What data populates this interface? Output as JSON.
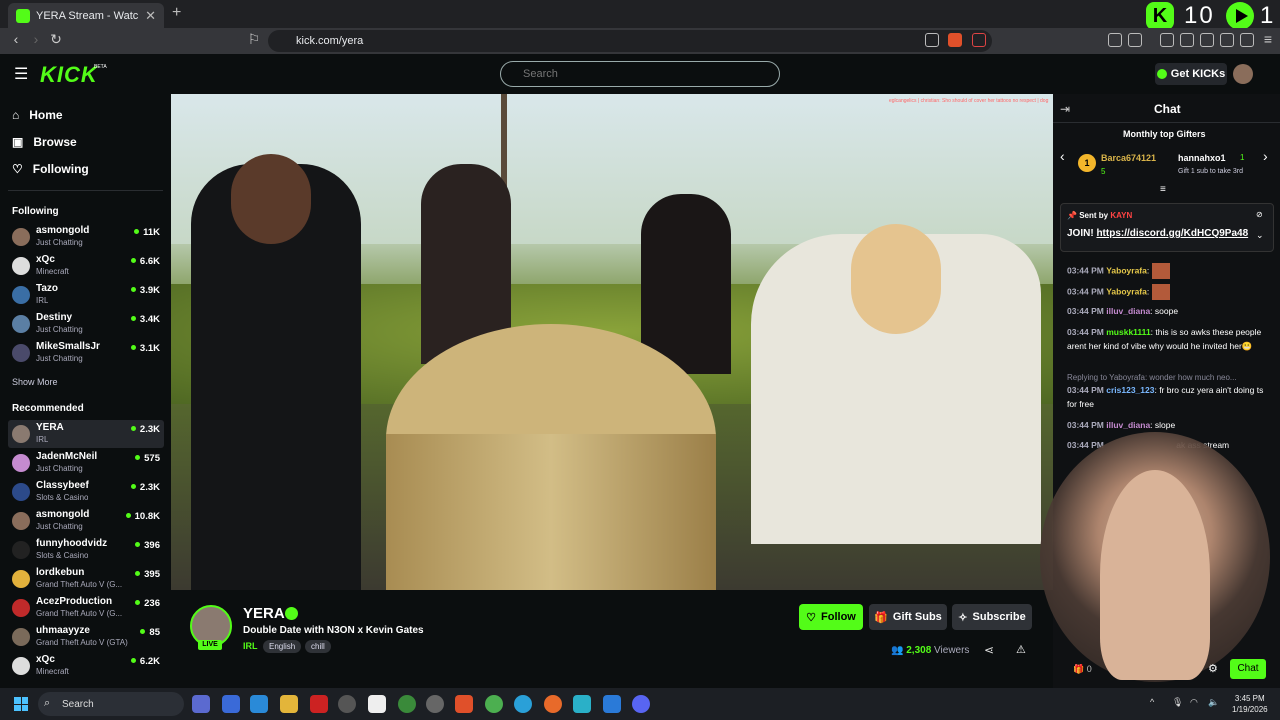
{
  "browser": {
    "tab_title": "YERA Stream - Watch Live on Kick",
    "url": "kick.com/yera",
    "ext_counter": "10",
    "ext_extra": "1"
  },
  "header": {
    "logo": "KICK",
    "beta": "BETA",
    "search_placeholder": "Search",
    "get_kicks": "Get KICKs"
  },
  "sidebar": {
    "nav": [
      {
        "label": "Home",
        "icon": "home-icon"
      },
      {
        "label": "Browse",
        "icon": "browse-icon"
      },
      {
        "label": "Following",
        "icon": "heart-icon"
      }
    ],
    "following_heading": "Following",
    "following": [
      {
        "name": "asmongold",
        "category": "Just Chatting",
        "viewers": "11K",
        "color": "#8a6d5b"
      },
      {
        "name": "xQc",
        "category": "Minecraft",
        "viewers": "6.6K",
        "color": "#ddd"
      },
      {
        "name": "Tazo",
        "category": "IRL",
        "viewers": "3.9K",
        "color": "#3a6ea5"
      },
      {
        "name": "Destiny",
        "category": "Just Chatting",
        "viewers": "3.4K",
        "color": "#5b7fa4"
      },
      {
        "name": "MikeSmallsJr",
        "category": "Just Chatting",
        "viewers": "3.1K",
        "color": "#4a4a6a"
      }
    ],
    "show_more": "Show More",
    "recommended_heading": "Recommended",
    "recommended": [
      {
        "name": "YERA",
        "category": "IRL",
        "viewers": "2.3K",
        "color": "#8a7a70"
      },
      {
        "name": "JadenMcNeil",
        "category": "Just Chatting",
        "viewers": "575",
        "color": "#c58bd0"
      },
      {
        "name": "Classybeef",
        "category": "Slots & Casino",
        "viewers": "2.3K",
        "color": "#2c4a8a"
      },
      {
        "name": "asmongold",
        "category": "Just Chatting",
        "viewers": "10.8K",
        "color": "#8a6d5b"
      },
      {
        "name": "funnyhoodvidz",
        "category": "Slots & Casino",
        "viewers": "396",
        "color": "#222"
      },
      {
        "name": "lordkebun",
        "category": "Grand Theft Auto V (G...",
        "viewers": "395",
        "color": "#e2b13c"
      },
      {
        "name": "AcezProduction",
        "category": "Grand Theft Auto V (G...",
        "viewers": "236",
        "color": "#c02a2a"
      },
      {
        "name": "uhmaayyze",
        "category": "Grand Theft Auto V (GTA)",
        "viewers": "85",
        "color": "#7a6a5a"
      },
      {
        "name": "xQc",
        "category": "Minecraft",
        "viewers": "6.2K",
        "color": "#ddd"
      }
    ]
  },
  "video": {
    "overlay_chat": "eglcangelics | christian: Sho should of cover her tattoos no respect | dog"
  },
  "stream": {
    "name": "YERA",
    "title": "Double Date with N3ON x Kevin Gates",
    "category": "IRL",
    "tags": [
      "English",
      "chill"
    ],
    "live": "LIVE",
    "viewers": "2,308",
    "viewers_label": "Viewers",
    "follow": "Follow",
    "gift_subs": "Gift Subs",
    "subscribe": "Subscribe"
  },
  "chat": {
    "title": "Chat",
    "gifters_heading": "Monthly top Gifters",
    "gifter1": {
      "rank": "1",
      "name": "Barca674121",
      "count": "5"
    },
    "gifter2": {
      "name": "hannahxo1",
      "count": "1",
      "note": "Gift 1 sub to take 3rd"
    },
    "pinned_by": "Sent by",
    "pinned_user": "KAYN",
    "pinned_msg_prefix": "JOIN!",
    "pinned_link": "https://discord.gg/KdHCQ9Pa48",
    "messages": [
      {
        "time": "03:44 PM",
        "user": "Yaboyrafa",
        "text": "",
        "color": "#e5c84a"
      },
      {
        "time": "03:44 PM",
        "user": "Yaboyrafa",
        "text": "",
        "color": "#e5c84a"
      },
      {
        "time": "03:44 PM",
        "user": "illuv_diana",
        "text": "soope",
        "color": "#c58bd0"
      },
      {
        "time": "03:44 PM",
        "user": "muskk1111",
        "text": "this is so awks these people arent her kind of vibe why would he invited her😬",
        "color": "#53fc18"
      }
    ],
    "reply": "Replying to Yaboyrafa: wonder how much neo...",
    "messages2": [
      {
        "time": "03:44 PM",
        "user": "cris123_123",
        "text": "fr bro cuz yera ain't doing ts for free",
        "color": "#7ab8ff"
      },
      {
        "time": "03:44 PM",
        "user": "illuv_diana",
        "text": "slope",
        "color": "#c58bd0"
      },
      {
        "time": "03:44 PM",
        "user": "",
        "text": "ak ass stream",
        "color": "#aaa"
      }
    ],
    "count": "0",
    "chat_button": "Chat"
  },
  "taskbar": {
    "search": "Search",
    "time": "3:45 PM",
    "date": "1/19/2026"
  },
  "colors": {
    "accent": "#53fc18",
    "bg": "#0b0e0f"
  }
}
